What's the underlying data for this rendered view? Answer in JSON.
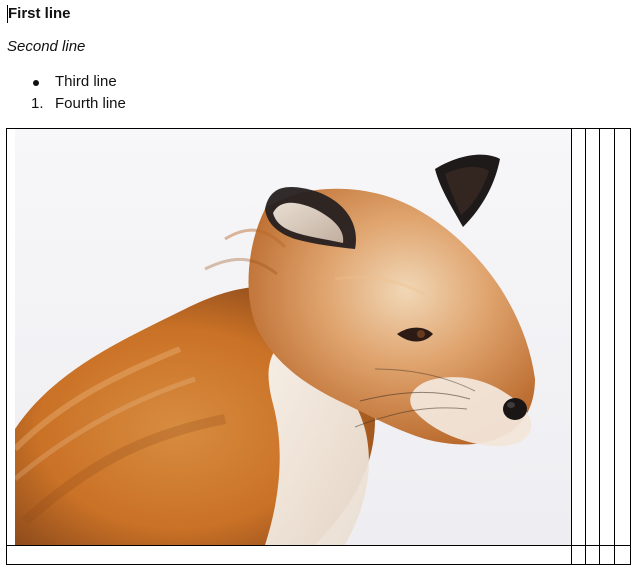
{
  "document": {
    "lines": [
      {
        "text": "First line",
        "style": "bold"
      },
      {
        "text": "Second line",
        "style": "italic"
      }
    ],
    "list_items": [
      {
        "marker": "bullet",
        "text": "Third line"
      },
      {
        "marker": "1.",
        "text": "Fourth line"
      }
    ]
  },
  "table": {
    "image_icon": "fox-photo-image"
  },
  "colors": {
    "text": "#111111",
    "border": "#000000",
    "background": "#ffffff"
  }
}
